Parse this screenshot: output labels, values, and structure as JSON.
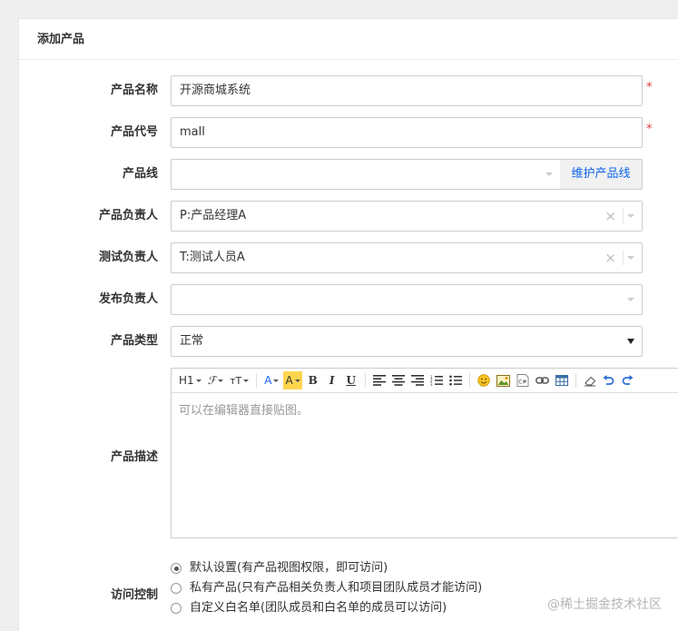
{
  "panel": {
    "title": "添加产品"
  },
  "form": {
    "name": {
      "label": "产品名称",
      "value": "开源商城系统",
      "required": "*"
    },
    "code": {
      "label": "产品代号",
      "value": "mall",
      "required": "*"
    },
    "line": {
      "label": "产品线",
      "value": "",
      "action": "维护产品线"
    },
    "owner": {
      "label": "产品负责人",
      "value": "P:产品经理A"
    },
    "qa": {
      "label": "测试负责人",
      "value": "T:测试人员A"
    },
    "release": {
      "label": "发布负责人",
      "value": ""
    },
    "type": {
      "label": "产品类型",
      "value": "正常"
    },
    "desc": {
      "label": "产品描述",
      "placeholder": "可以在编辑器直接贴图。",
      "toolbar": {
        "heading": "H1",
        "font": "ℱ",
        "size": "тT",
        "fore_color": "A",
        "back_color": "A",
        "bold": "B",
        "italic": "I",
        "underline": "U"
      }
    },
    "acl": {
      "label": "访问控制",
      "options": [
        "默认设置(有产品视图权限，即可访问)",
        "私有产品(只有产品相关负责人和项目团队成员才能访问)",
        "自定义白名单(团队成员和白名单的成员可以访问)"
      ],
      "selected": 0
    }
  },
  "watermark": "@稀土掘金技术社区",
  "colors": {
    "accent": "#0c64eb",
    "required": "#e4393c",
    "highlight": "#ffd54f"
  }
}
